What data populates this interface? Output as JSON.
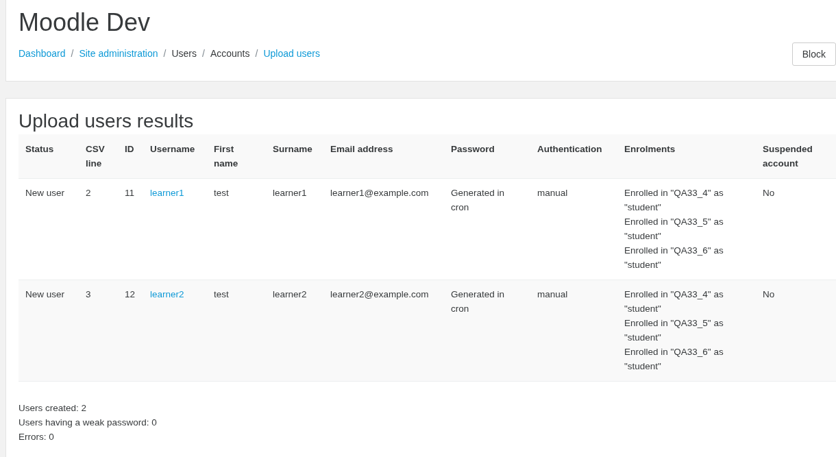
{
  "site_title": "Moodle Dev",
  "breadcrumb": [
    {
      "label": "Dashboard",
      "link": true
    },
    {
      "label": "Site administration",
      "link": true
    },
    {
      "label": "Users",
      "link": false
    },
    {
      "label": "Accounts",
      "link": false
    },
    {
      "label": "Upload users",
      "link": true
    }
  ],
  "breadcrumb_separator": "/",
  "header_button": "Block",
  "heading": "Upload users results",
  "table": {
    "columns": [
      "Status",
      "CSV line",
      "ID",
      "Username",
      "First name",
      "Surname",
      "Email address",
      "Password",
      "Authentication",
      "Enrolments",
      "Suspended account"
    ],
    "rows": [
      {
        "status": "New user",
        "csv_line": "2",
        "id": "11",
        "username": "learner1",
        "first_name": "test",
        "surname": "learner1",
        "email": "learner1@example.com",
        "password": "Generated in cron",
        "authentication": "manual",
        "enrolments": [
          "Enrolled in \"QA33_4\" as \"student\"",
          "Enrolled in \"QA33_5\" as \"student\"",
          "Enrolled in \"QA33_6\" as \"student\""
        ],
        "suspended": "No"
      },
      {
        "status": "New user",
        "csv_line": "3",
        "id": "12",
        "username": "learner2",
        "first_name": "test",
        "surname": "learner2",
        "email": "learner2@example.com",
        "password": "Generated in cron",
        "authentication": "manual",
        "enrolments": [
          "Enrolled in \"QA33_4\" as \"student\"",
          "Enrolled in \"QA33_5\" as \"student\"",
          "Enrolled in \"QA33_6\" as \"student\""
        ],
        "suspended": "No"
      }
    ]
  },
  "summary": [
    "Users created: 2",
    "Users having a weak password: 0",
    "Errors: 0"
  ]
}
